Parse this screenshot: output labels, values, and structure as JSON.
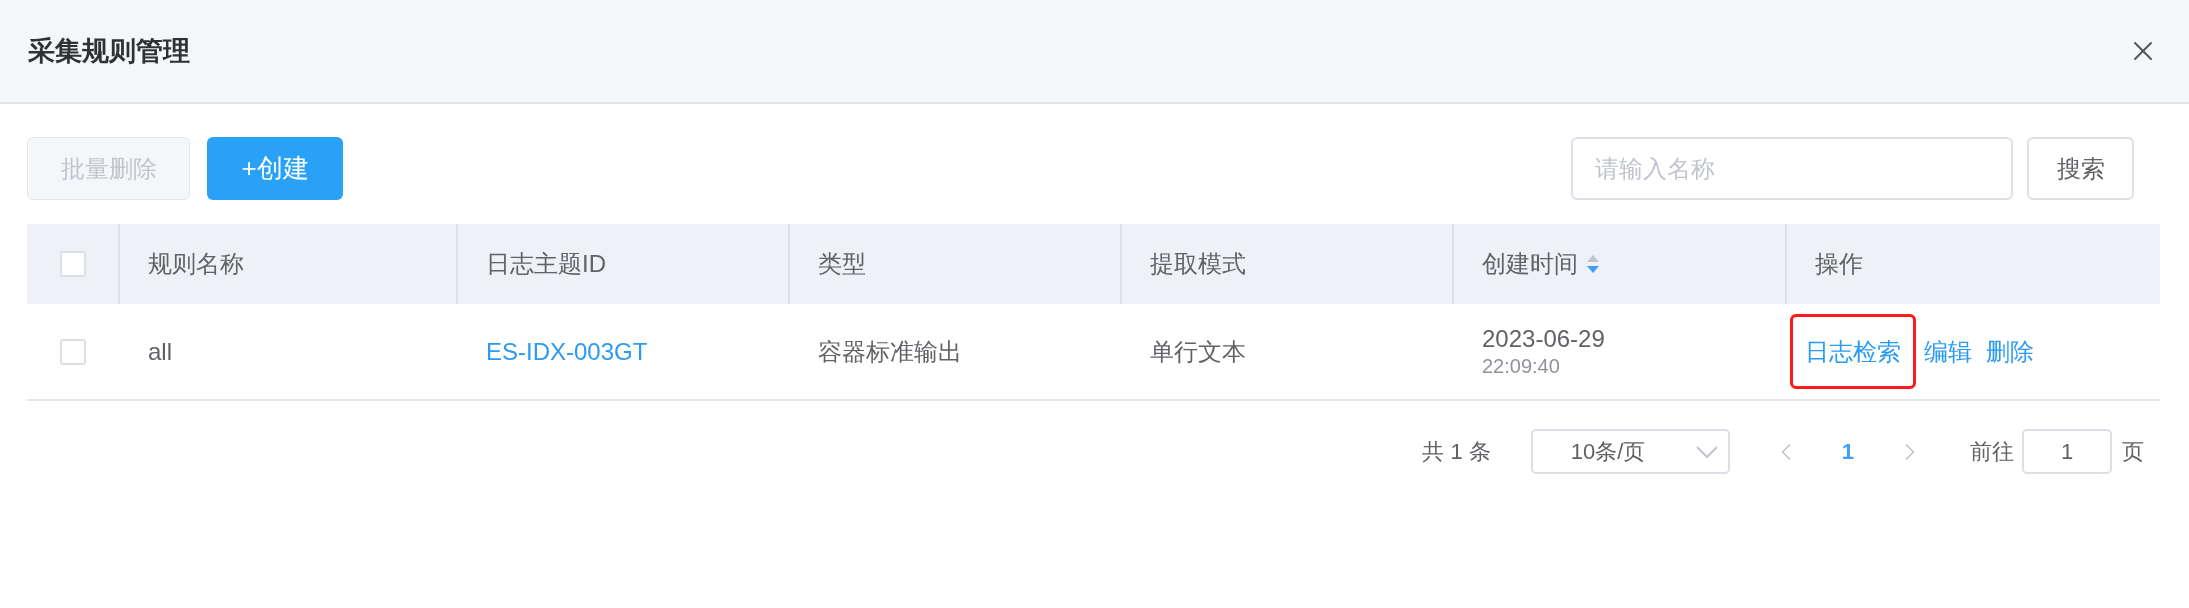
{
  "dialog": {
    "title": "采集规则管理"
  },
  "toolbar": {
    "batch_delete": {
      "label": "批量删除",
      "disabled": true
    },
    "create": {
      "label": "+创建"
    },
    "search": {
      "placeholder": "请输入名称",
      "button": "搜索"
    }
  },
  "table": {
    "select_all_checked": false,
    "columns": [
      {
        "label": "规则名称",
        "sortable": false
      },
      {
        "label": "日志主题ID",
        "sortable": false
      },
      {
        "label": "类型",
        "sortable": false
      },
      {
        "label": "提取模式",
        "sortable": false
      },
      {
        "label": "创建时间",
        "sortable": true,
        "descending": true
      },
      {
        "label": "操作",
        "sortable": false
      }
    ],
    "rows": [
      {
        "checked": false,
        "name": "all",
        "topic_id": "ES-IDX-003GT",
        "type": "容器标准输出",
        "mode": "单行文本",
        "created_date": "2023-06-29",
        "created_time": "22:09:40",
        "actions": [
          {
            "label": "日志检索",
            "highlighted": true
          },
          {
            "label": "编辑",
            "highlighted": false
          },
          {
            "label": "删除",
            "highlighted": false
          }
        ]
      }
    ]
  },
  "pagination": {
    "total": "共 1 条",
    "page_size": "10条/页",
    "pages": [
      {
        "label": "1",
        "selected": true
      }
    ],
    "goto_label": "前往",
    "goto_value": "1",
    "goto_suffix": "页"
  }
}
